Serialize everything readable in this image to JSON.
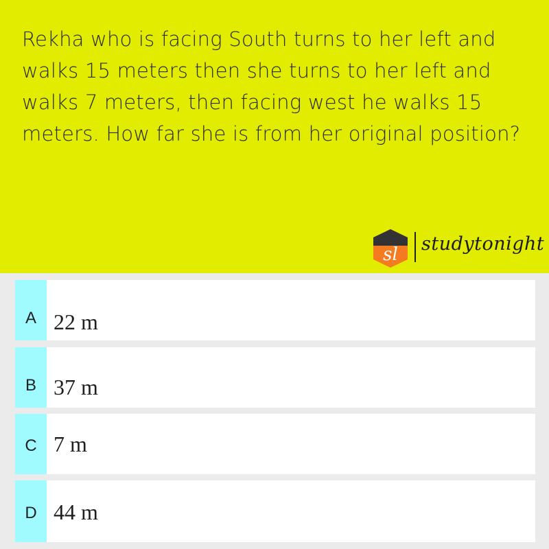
{
  "question": {
    "text": "Rekha who is facing South turns to her left and walks 15 meters then she turns to her left and walks 7 meters, then facing west he walks 15 meters. How far she is from her original position?"
  },
  "brand": {
    "badge_text": "sl",
    "name": "studytonight",
    "icon": "studytonight-logo-icon"
  },
  "options": [
    {
      "letter": "A",
      "text": "22 m"
    },
    {
      "letter": "B",
      "text": "37 m"
    },
    {
      "letter": "C",
      "text": "7 m"
    },
    {
      "letter": "D",
      "text": "44 m"
    }
  ],
  "colors": {
    "question_background": "#e1ec00",
    "option_letter_background": "#9ffbff",
    "page_background": "#ebebeb",
    "logo_orange": "#f47b20",
    "logo_dark": "#333333"
  }
}
